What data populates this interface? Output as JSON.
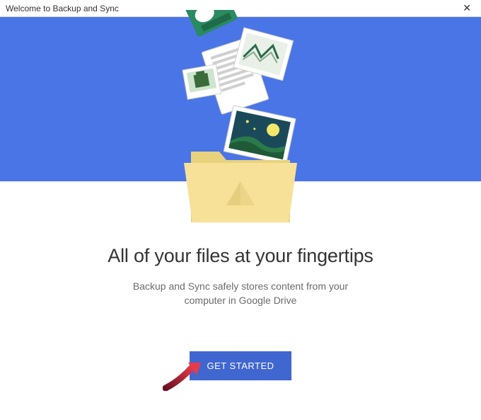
{
  "titlebar": {
    "title": "Welcome to Backup and Sync",
    "close_label": "✕"
  },
  "content": {
    "headline": "All of your files at your fingertips",
    "subtext_line1": "Backup and Sync safely stores content from your",
    "subtext_line2": "computer in Google Drive",
    "cta_label": "GET STARTED"
  },
  "icons": {
    "folder": "folder-icon",
    "documents": "documents-icon",
    "photos": "photos-icon",
    "arrow": "annotation-arrow-icon"
  },
  "colors": {
    "hero_bg": "#4a75e6",
    "cta_bg": "#4066d0",
    "folder": "#f7e199",
    "folder_shade": "#e8d27d"
  }
}
